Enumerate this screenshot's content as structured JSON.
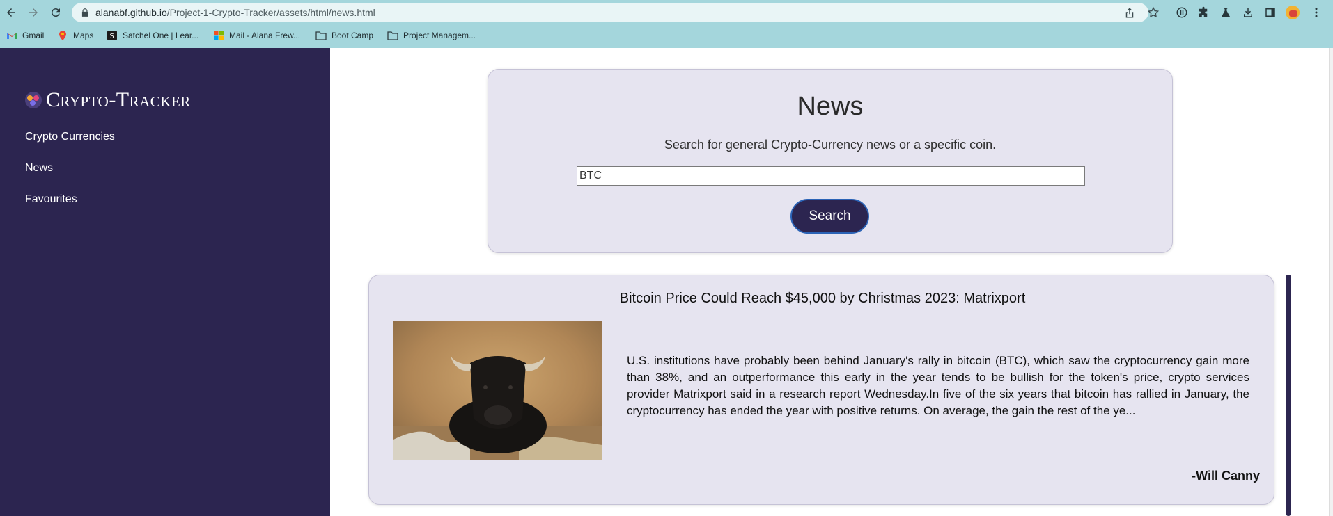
{
  "browser": {
    "url_host": "alanabf.github.io",
    "url_path": "/Project-1-Crypto-Tracker/assets/html/news.html",
    "bookmarks": [
      {
        "label": "Gmail",
        "icon": "gmail-icon"
      },
      {
        "label": "Maps",
        "icon": "maps-icon"
      },
      {
        "label": "Satchel One | Lear...",
        "icon": "satchel-icon"
      },
      {
        "label": "Mail - Alana Frew...",
        "icon": "microsoft-icon"
      },
      {
        "label": "Boot Camp",
        "icon": "folder-icon"
      },
      {
        "label": "Project Managem...",
        "icon": "folder-icon"
      }
    ]
  },
  "sidebar": {
    "title": "Crypto-Tracker",
    "links": [
      {
        "label": "Crypto Currencies"
      },
      {
        "label": "News"
      },
      {
        "label": "Favourites"
      }
    ]
  },
  "search": {
    "title": "News",
    "subtitle": "Search for general Crypto-Currency news or a specific coin.",
    "value": "BTC",
    "button_label": "Search"
  },
  "article": {
    "title": "Bitcoin Price Could Reach $45,000 by Christmas 2023: Matrixport",
    "body": "U.S. institutions have probably been behind January's rally in bitcoin (BTC), which saw the cryptocurrency gain more than 38%, and an outperformance this early in the year tends to be bullish for the token's price, crypto services provider Matrixport said in a research report Wednesday.In five of the six years that bitcoin has rallied in January, the cryptocurrency has ended the year with positive returns. On average, the gain the rest of the ye...",
    "author": "-Will Canny",
    "image": "bull-photo"
  },
  "colors": {
    "chrome": "#a4d6dc",
    "sidebar": "#2c2550",
    "card": "#e6e4f0",
    "button_border": "#2b63b6"
  }
}
